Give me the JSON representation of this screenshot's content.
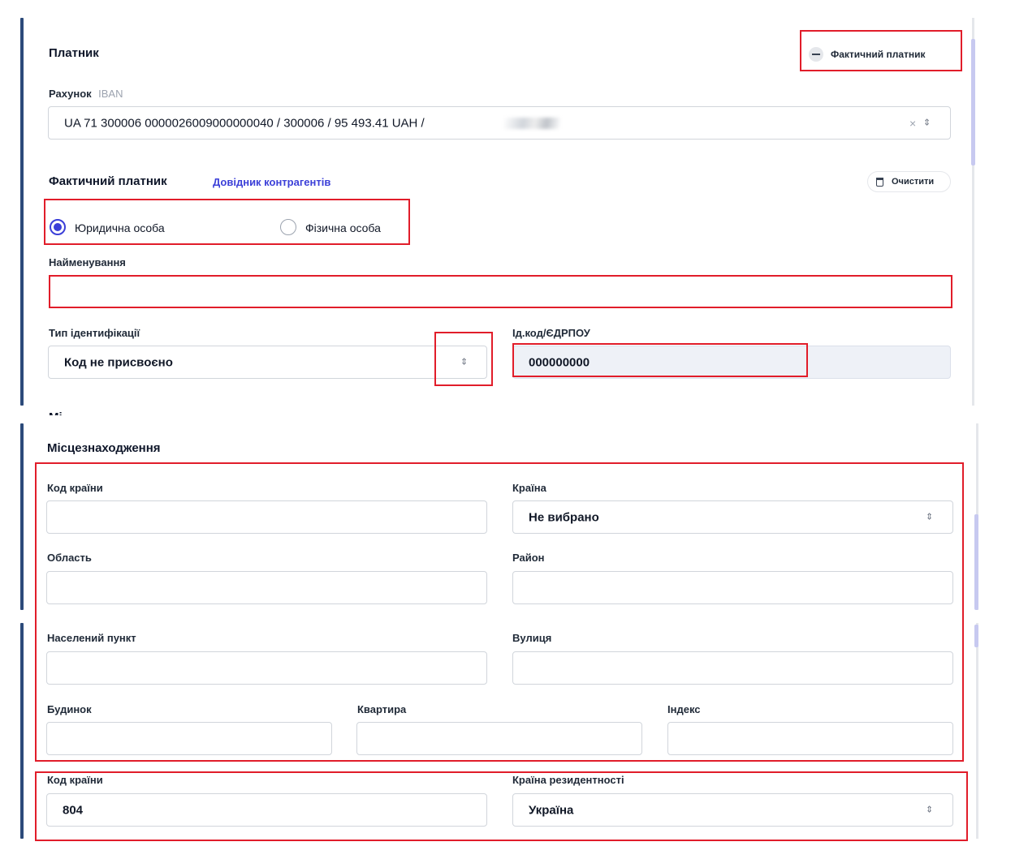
{
  "payer": {
    "title": "Платник",
    "actual_payer_toggle_label": "Фактичний платник",
    "account_label": "Рахунок",
    "account_hint": "IBAN",
    "account_value": "UA 71 300006 0000026009000000040 / 300006 / 95 493.41 UAH /"
  },
  "actual_payer": {
    "title": "Фактичний платник",
    "directory_link": "Довідник контрагентів",
    "clear_label": "Очистити",
    "radio_legal": "Юридична особа",
    "radio_individual": "Фізична особа",
    "selected": "legal",
    "name_label": "Найменування",
    "name_value": "",
    "id_type_label": "Тип ідентифікації",
    "id_type_value": "Код не присвоєно",
    "id_code_label": "Ід.код/ЄДРПОУ",
    "id_code_value": "000000000",
    "cut_heading": "Мі"
  },
  "location": {
    "title": "Місцезнаходження",
    "country_code_label": "Код країни",
    "country_code_value": "",
    "country_label": "Країна",
    "country_value": "Не вибрано",
    "region_label": "Область",
    "region_value": "",
    "district_label": "Район",
    "district_value": "",
    "settlement_label": "Населений пункт",
    "settlement_value": "",
    "street_label": "Вулиця",
    "street_value": "",
    "building_label": "Будинок",
    "building_value": "",
    "apartment_label": "Квартира",
    "apartment_value": "",
    "index_label": "Індекс",
    "index_value": ""
  },
  "residency": {
    "country_code_label": "Код країни",
    "country_code_value": "804",
    "country_label": "Країна резидентності",
    "country_value": "Україна"
  },
  "icons": {
    "minus": "minus-circle-icon",
    "trash": "trash-icon",
    "sort": "sort-arrows-icon",
    "clear": "clear-x-icon"
  },
  "colors": {
    "accent": "#3b3fd8",
    "highlight_border": "#e11d2a",
    "left_bar": "#2c4a7a",
    "readonly_bg": "#eef1f7"
  }
}
